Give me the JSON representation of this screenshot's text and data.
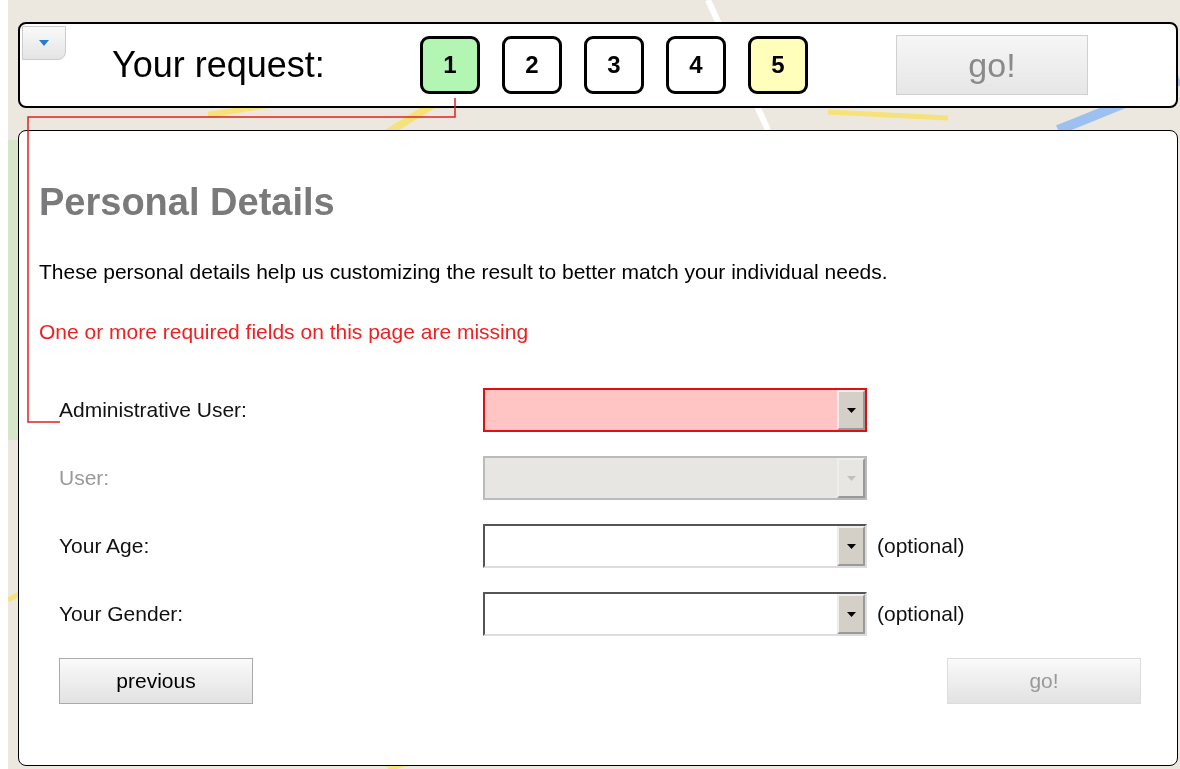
{
  "request_bar": {
    "label": "Your request:",
    "steps": [
      {
        "label": "1",
        "color": "#b3f5b3"
      },
      {
        "label": "2",
        "color": "#ffffff"
      },
      {
        "label": "3",
        "color": "#ffffff"
      },
      {
        "label": "4",
        "color": "#ffffff"
      },
      {
        "label": "5",
        "color": "#ffffbb"
      }
    ],
    "go_button": {
      "label": "go!",
      "disabled": true
    }
  },
  "panel": {
    "title": "Personal Details",
    "intro": "These personal details help us customizing the result to better match your individual needs.",
    "error": "One or more required fields on this page are missing",
    "fields": [
      {
        "label": "Administrative User:",
        "invalid": true,
        "disabled": false
      },
      {
        "label": "User:",
        "invalid": false,
        "disabled": true
      },
      {
        "label": "Your Age:",
        "invalid": false,
        "disabled": false,
        "note": "(optional)"
      },
      {
        "label": "Your Gender:",
        "invalid": false,
        "disabled": false,
        "note": "(optional)"
      }
    ],
    "previous_button": {
      "label": "previous",
      "disabled": false
    },
    "go_button": {
      "label": "go!",
      "disabled": true
    }
  }
}
